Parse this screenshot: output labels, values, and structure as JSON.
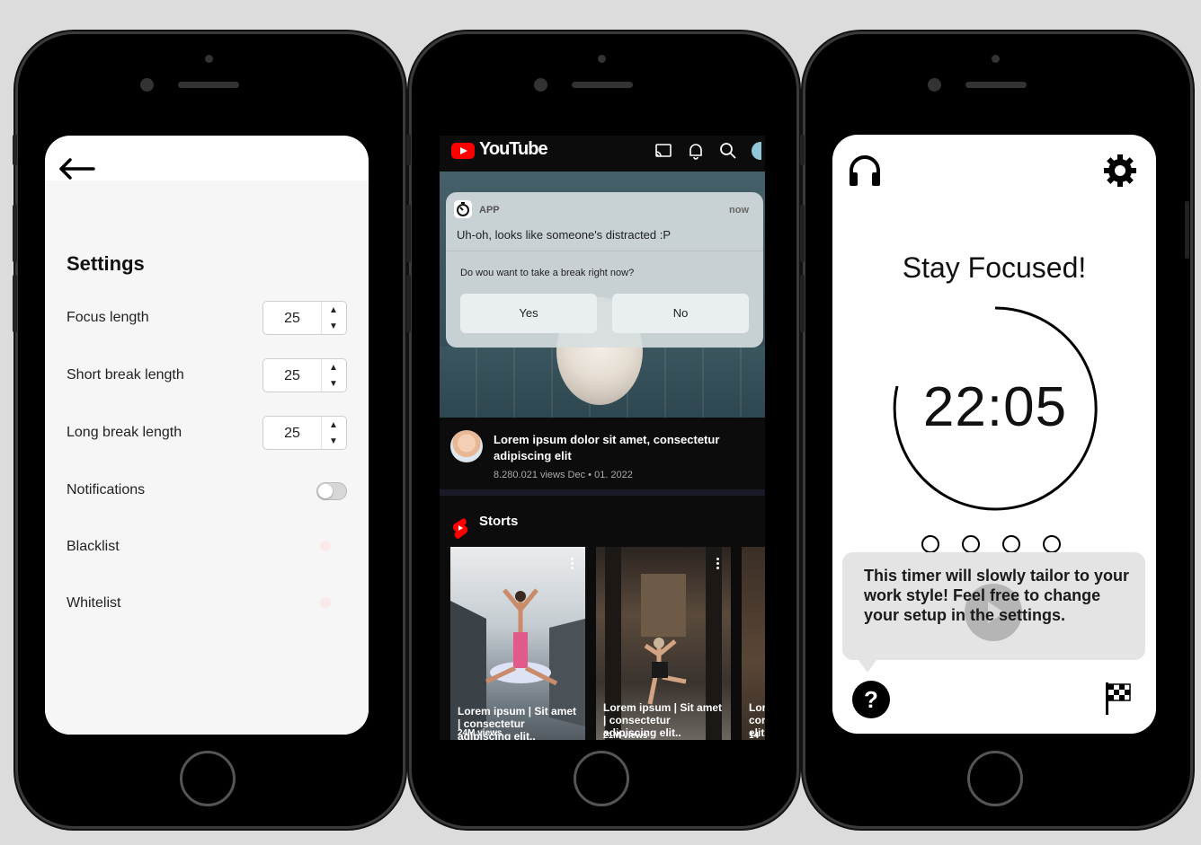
{
  "settings_screen": {
    "title": "Settings",
    "rows": [
      {
        "label": "Focus length",
        "value": "25"
      },
      {
        "label": "Short break length",
        "value": "25"
      },
      {
        "label": "Long break length",
        "value": "25"
      }
    ],
    "notifications_label": "Notifications",
    "notifications_enabled": false,
    "blacklist_label": "Blacklist",
    "whitelist_label": "Whitelist",
    "icons": [
      "back-arrow-icon",
      "stepper-up-icon",
      "stepper-down-icon"
    ]
  },
  "youtube_screen": {
    "logo_text": "YouTube",
    "header_icons": [
      "cast-icon",
      "bell-icon",
      "search-icon",
      "avatar-icon"
    ],
    "notification": {
      "app": "APP",
      "time": "now",
      "message": "Uh-oh, looks like someone's distracted :P",
      "question": "Do wou want to take a break right now?",
      "yes_label": "Yes",
      "no_label": "No"
    },
    "video": {
      "title": "Lorem ipsum dolor sit amet, consectetur adipiscing elit",
      "meta": "8.280.021 views Dec • 01. 2022"
    },
    "shorts_title": "Storts",
    "shorts": [
      {
        "title": "Lorem ipsum | Sit amet | consectetur adipiscing elit..",
        "views": "24M views"
      },
      {
        "title": "Lorem ipsum | Sit amet | consectetur adipiscing elit..",
        "views": "21M views"
      },
      {
        "title": "Lor con elit",
        "views": "14"
      }
    ],
    "brand_color": "#ff0000"
  },
  "timer_screen": {
    "title": "Stay Focused!",
    "time": "22:05",
    "progress_dots": 4,
    "tip": "This timer will slowly tailor to your work style! Feel free to change your setup in the settings.",
    "help_label": "?",
    "icons": [
      "headphones-icon",
      "gear-icon",
      "play-icon",
      "finish-flag-icon"
    ]
  }
}
